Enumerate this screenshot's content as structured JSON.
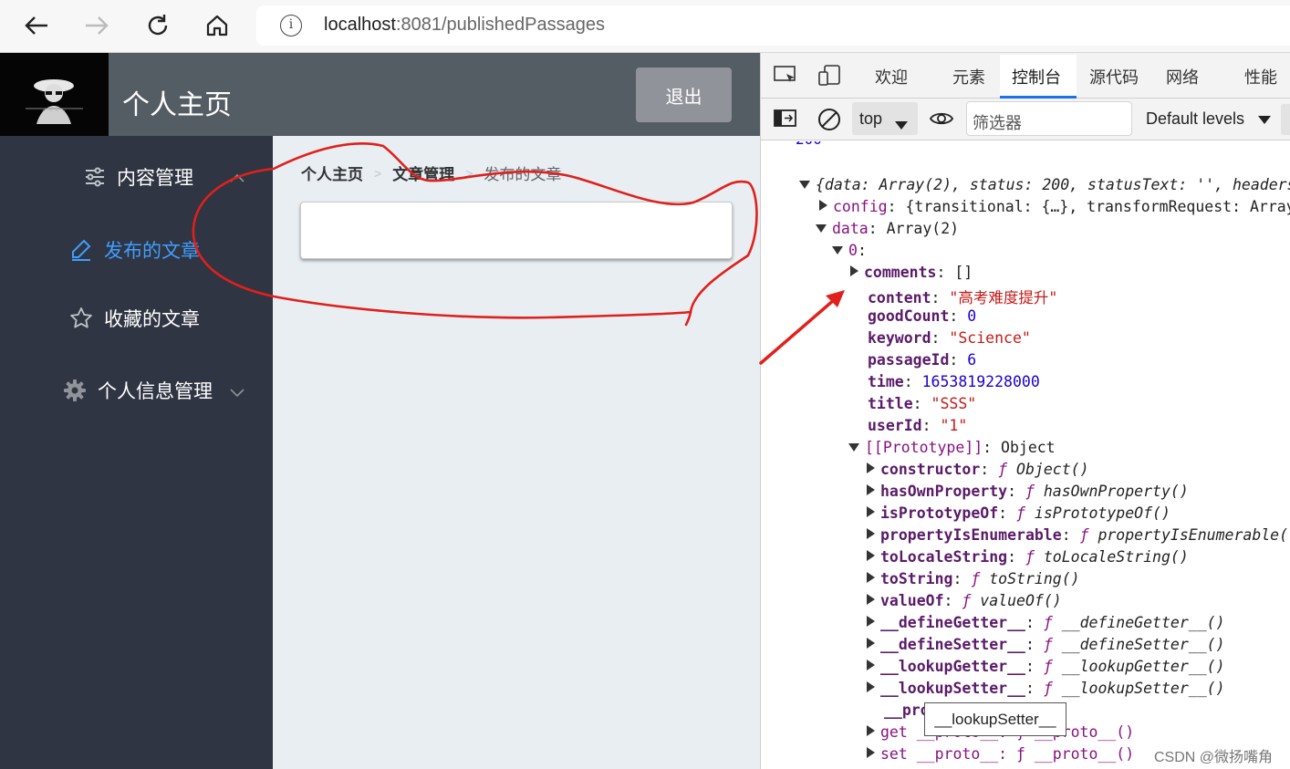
{
  "browser": {
    "url_host": "localhost",
    "url_path": ":8081/publishedPassages"
  },
  "app": {
    "title": "个人主页",
    "logout_label": "退出",
    "sidebar": {
      "content_mgmt": "内容管理",
      "published": "发布的文章",
      "favorites": "收藏的文章",
      "profile_mgmt": "个人信息管理"
    },
    "breadcrumb": [
      "个人主页",
      "文章管理",
      "发布的文章"
    ],
    "accent_color": "#409eff"
  },
  "devtools": {
    "tabs": [
      "欢迎",
      "元素",
      "控制台",
      "源代码",
      "网络",
      "性能"
    ],
    "active_tab": "控制台",
    "context": "top",
    "filter_placeholder": "筛选器",
    "levels": "Default levels",
    "console": {
      "top_partial": "200",
      "response_summary": "{data: Array(2), status: 200, statusText: '', headers",
      "config_line": "{transitional: {…}, transformRequest: Array",
      "data_label": "Array(2)",
      "item0": {
        "comments": "[]",
        "content": "\"高考难度提升\"",
        "goodCount": "0",
        "keyword": "\"Science\"",
        "passageId": "6",
        "time": "1653819228000",
        "title": "\"SSS\"",
        "userId": "\"1\""
      },
      "prototype_label": "Object",
      "proto_methods": [
        {
          "name": "constructor",
          "val": "Object()"
        },
        {
          "name": "hasOwnProperty",
          "val": "hasOwnProperty()"
        },
        {
          "name": "isPrototypeOf",
          "val": "isPrototypeOf()"
        },
        {
          "name": "propertyIsEnumerable",
          "val": "propertyIsEnumerable("
        },
        {
          "name": "toLocaleString",
          "val": "toLocaleString()"
        },
        {
          "name": "toString",
          "val": "toString()"
        },
        {
          "name": "valueOf",
          "val": "valueOf()"
        },
        {
          "name": "__defineGetter__",
          "val": "__defineGetter__()"
        },
        {
          "name": "__defineSetter__",
          "val": "__defineSetter__()"
        },
        {
          "name": "__lookupGetter__",
          "val": "__lookupGetter__()"
        },
        {
          "name": "__lookupSetter__",
          "val": "__lookupSetter__()"
        }
      ],
      "proto_partial": "__pro",
      "get_proto": "get __proto__: ƒ __proto__()",
      "set_proto": "set __proto__: ƒ __proto__()"
    },
    "tooltip": "__lookupSetter__"
  },
  "watermark": "CSDN @微扬嘴角",
  "annotation_color": "#e0201c"
}
